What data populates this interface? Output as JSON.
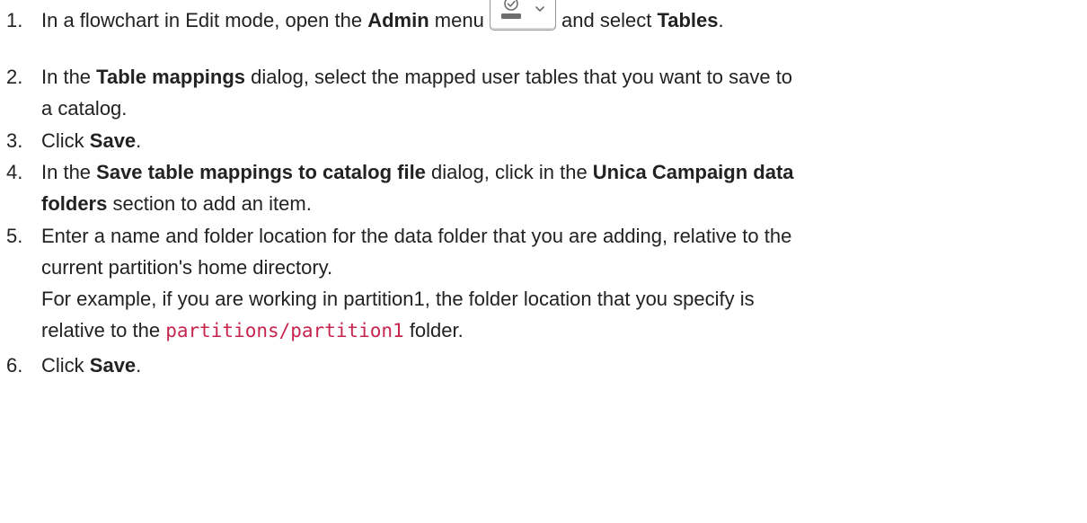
{
  "steps": [
    {
      "number": "1.",
      "parts": {
        "t1": "In a flowchart in Edit mode, open the ",
        "b1": "Admin",
        "t2": " menu ",
        "t3": " and select ",
        "b2": "Tables",
        "t4": "."
      },
      "icon": "admin-menu-icon"
    },
    {
      "number": "2.",
      "parts": {
        "t1": "In the ",
        "b1": "Table mappings",
        "t2": " dialog, select the mapped user tables that you want to save to",
        "t3": "a catalog."
      }
    },
    {
      "number": "3.",
      "parts": {
        "t1": "Click ",
        "b1": "Save",
        "t2": "."
      }
    },
    {
      "number": "4.",
      "parts": {
        "t1": "In the ",
        "b1": "Save table mappings to catalog file",
        "t2": " dialog, click in the  ",
        "b2": "Unica Campaign data",
        "b3": "folders",
        "t3": " section to add an item."
      }
    },
    {
      "number": "5.",
      "parts": {
        "t1": "Enter a name and folder location for the data folder that you are adding, relative to the",
        "t2": "current partition's home directory.",
        "t3": "For example, if you are working in partition1, the folder location that you specify is",
        "t4": "relative to the ",
        "code": "partitions/partition1",
        "t5": " folder."
      }
    },
    {
      "number": "6.",
      "parts": {
        "t1": "Click ",
        "b1": "Save",
        "t2": "."
      }
    }
  ],
  "colors": {
    "text": "#222222",
    "code": "#c7254e",
    "icon_border": "#9a9a9a",
    "icon_glyph": "#6e6e6e"
  }
}
